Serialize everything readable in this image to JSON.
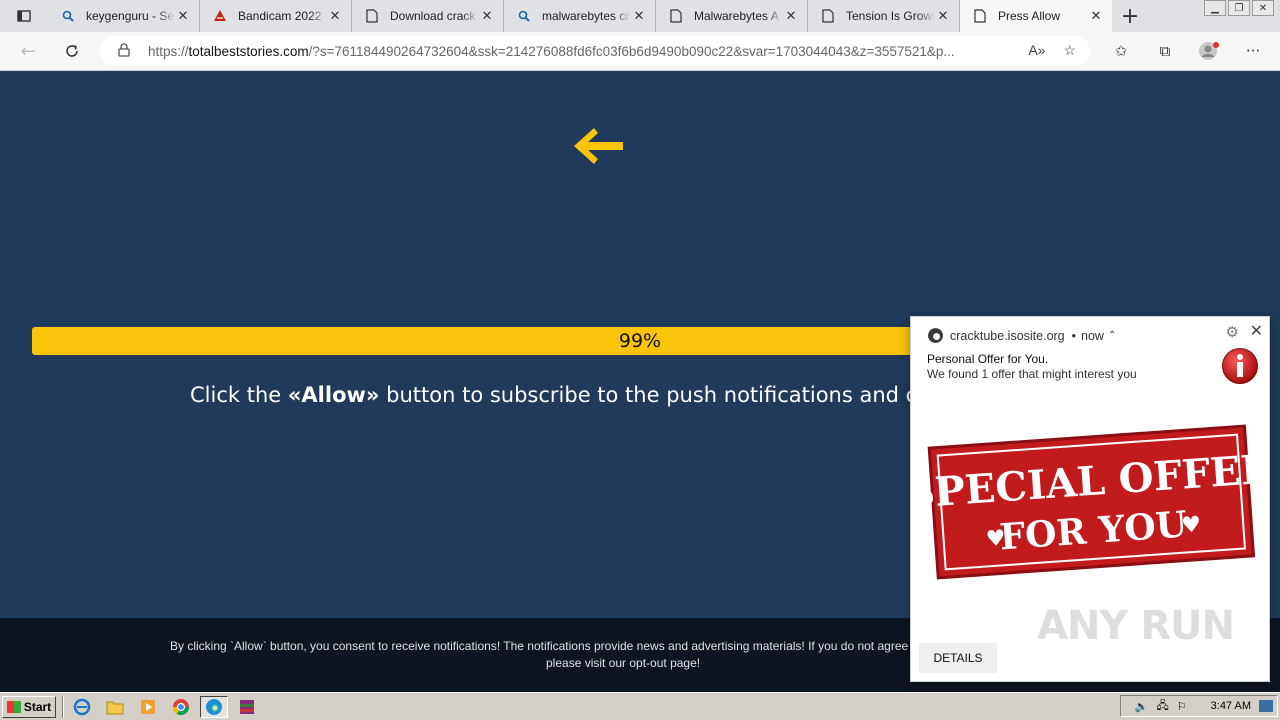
{
  "browser": {
    "tabs": [
      {
        "title": "keygenguru - Se",
        "icon": "search-icon"
      },
      {
        "title": "Bandicam 2022",
        "icon": "bandicam-icon"
      },
      {
        "title": "Download crack",
        "icon": "page-icon"
      },
      {
        "title": "malwarebytes cr",
        "icon": "search-icon"
      },
      {
        "title": "Malwarebytes A",
        "icon": "page-icon"
      },
      {
        "title": "Tension Is Growi",
        "icon": "page-icon"
      },
      {
        "title": "Press Allow",
        "icon": "page-icon",
        "active": true
      }
    ],
    "address": {
      "prefix": "https://",
      "domain": "totalbeststories.com",
      "path": "/?s=761184490264732604&ssk=214276088fd6fc03f6b6d9490b090c22&svar=1703044043&z=3557521&p..."
    }
  },
  "page": {
    "background": "#1f3a5a",
    "accent": "#f9c40a",
    "progress_value": 0.99,
    "progress_text": "99%",
    "instruction_before": "Click the ",
    "instruction_allow": "«Allow»",
    "instruction_after": " button to subscribe to the push notifications and continue watching",
    "footer_line1": "By clicking `Allow` button, you consent to receive notifications! The notifications provide news and advertising materials! If you do not agree to receiving these notifications,",
    "footer_line2": "please visit our opt-out page!"
  },
  "notification": {
    "source": "cracktube.isosite.org",
    "time": "now",
    "title": "Personal Offer for You.",
    "body": "We found 1 offer that might interest you",
    "image_text_1": "SPECIAL OFFER",
    "image_text_2": "FOR YOU",
    "details_label": "DETAILS",
    "watermark": "ANY RUN"
  },
  "taskbar": {
    "start_label": "Start",
    "clock": "3:47 AM"
  }
}
